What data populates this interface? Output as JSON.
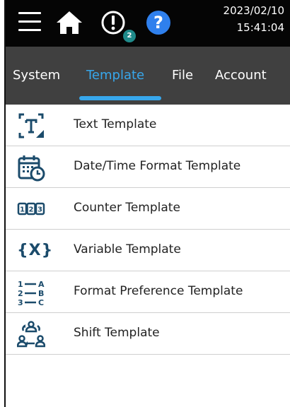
{
  "status": {
    "date": "2023/02/10",
    "time": "15:41:04",
    "alert_count": "2"
  },
  "icons": {
    "menu": "hamburger-menu-icon",
    "home": "home-icon",
    "alert": "alert-circle-icon",
    "help": "help-question-icon"
  },
  "tabs": [
    {
      "label": "System",
      "active": false
    },
    {
      "label": "Template",
      "active": true
    },
    {
      "label": "File",
      "active": false
    },
    {
      "label": "Account",
      "active": false
    }
  ],
  "templates": [
    {
      "label": "Text Template",
      "icon": "text-template-icon"
    },
    {
      "label": "Date/Time Format Template",
      "icon": "calendar-clock-icon"
    },
    {
      "label": "Counter Template",
      "icon": "counter-digits-icon"
    },
    {
      "label": "Variable Template",
      "icon": "variable-braces-icon",
      "glyph": "{X}"
    },
    {
      "label": "Format Preference Template",
      "icon": "format-mapping-icon"
    },
    {
      "label": "Shift Template",
      "icon": "shift-rotation-icon"
    }
  ],
  "colors": {
    "topbar": "#050505",
    "tabbar": "#404040",
    "accent": "#37a7ec",
    "icon": "#1b4b6b",
    "help": "#2f80ed",
    "badge": "#1f8a8a"
  }
}
